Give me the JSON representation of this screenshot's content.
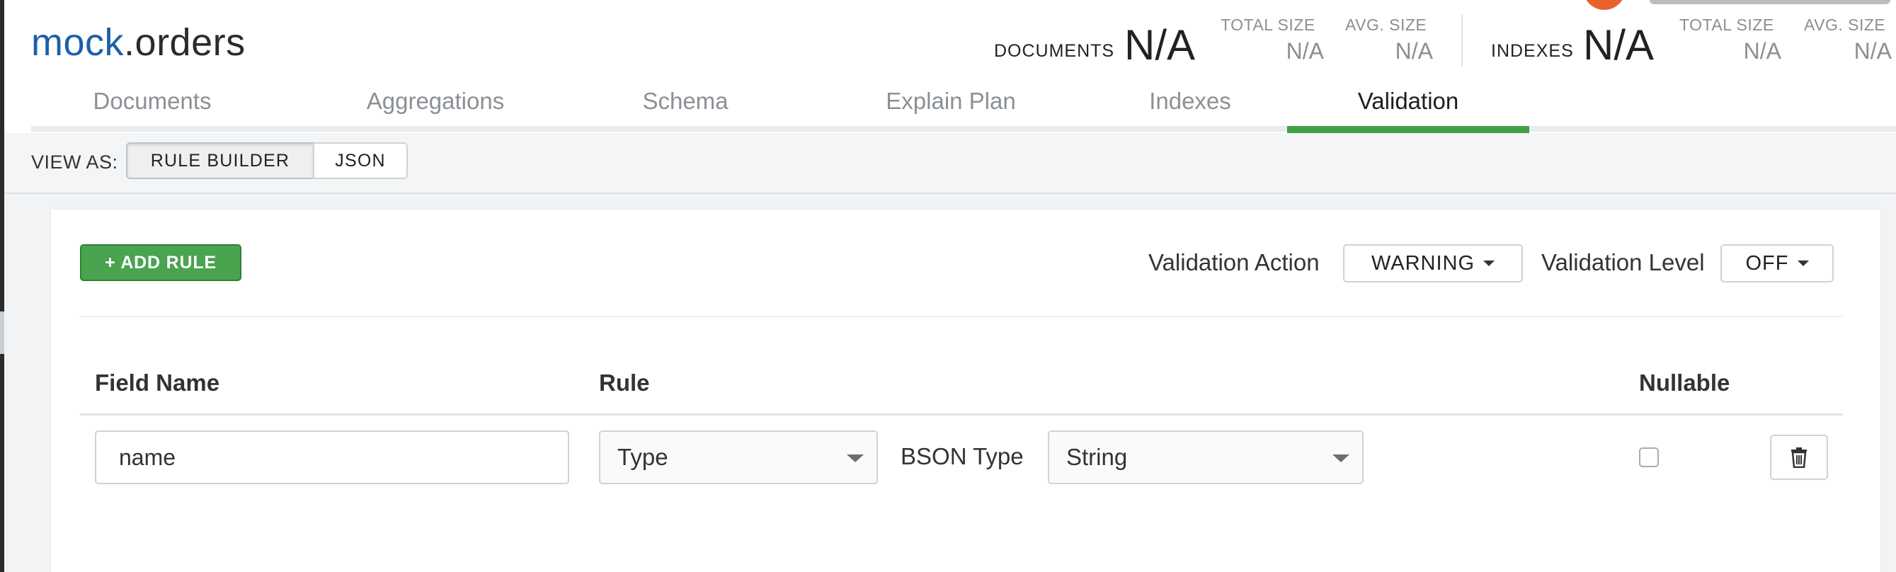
{
  "header": {
    "db_name": "mock",
    "separator": ".",
    "collection_name": "orders",
    "documents": {
      "label": "DOCUMENTS",
      "value": "N/A"
    },
    "doc_total_size": {
      "label": "TOTAL SIZE",
      "value": "N/A"
    },
    "doc_avg_size": {
      "label": "AVG. SIZE",
      "value": "N/A"
    },
    "indexes": {
      "label": "INDEXES",
      "value": "N/A"
    },
    "idx_total_size": {
      "label": "TOTAL SIZE",
      "value": "N/A"
    },
    "idx_avg_size": {
      "label": "AVG. SIZE",
      "value": "N/A"
    }
  },
  "tabs": [
    {
      "label": "Documents"
    },
    {
      "label": "Aggregations"
    },
    {
      "label": "Schema"
    },
    {
      "label": "Explain Plan"
    },
    {
      "label": "Indexes"
    },
    {
      "label": "Validation",
      "active": true
    }
  ],
  "view_as": {
    "label": "VIEW AS:",
    "options": [
      "RULE BUILDER",
      "JSON"
    ],
    "selected": "RULE BUILDER"
  },
  "toolbar": {
    "add_rule_label": "+ ADD RULE",
    "validation_action_label": "Validation Action",
    "validation_action_value": "WARNING",
    "validation_level_label": "Validation Level",
    "validation_level_value": "OFF"
  },
  "rules_table": {
    "columns": [
      "Field Name",
      "Rule",
      "Nullable"
    ],
    "rows": [
      {
        "field_name": "name",
        "rule": "Type",
        "bson_type_label": "BSON Type",
        "bson_type": "String",
        "nullable": false
      }
    ]
  },
  "icons": {
    "delete": "trash-icon",
    "dropdown": "caret-down-icon"
  },
  "colors": {
    "db_name": "#1d5fa8",
    "active_tab_underline": "#3f9f4a",
    "add_rule_button": "#4aa34f"
  }
}
